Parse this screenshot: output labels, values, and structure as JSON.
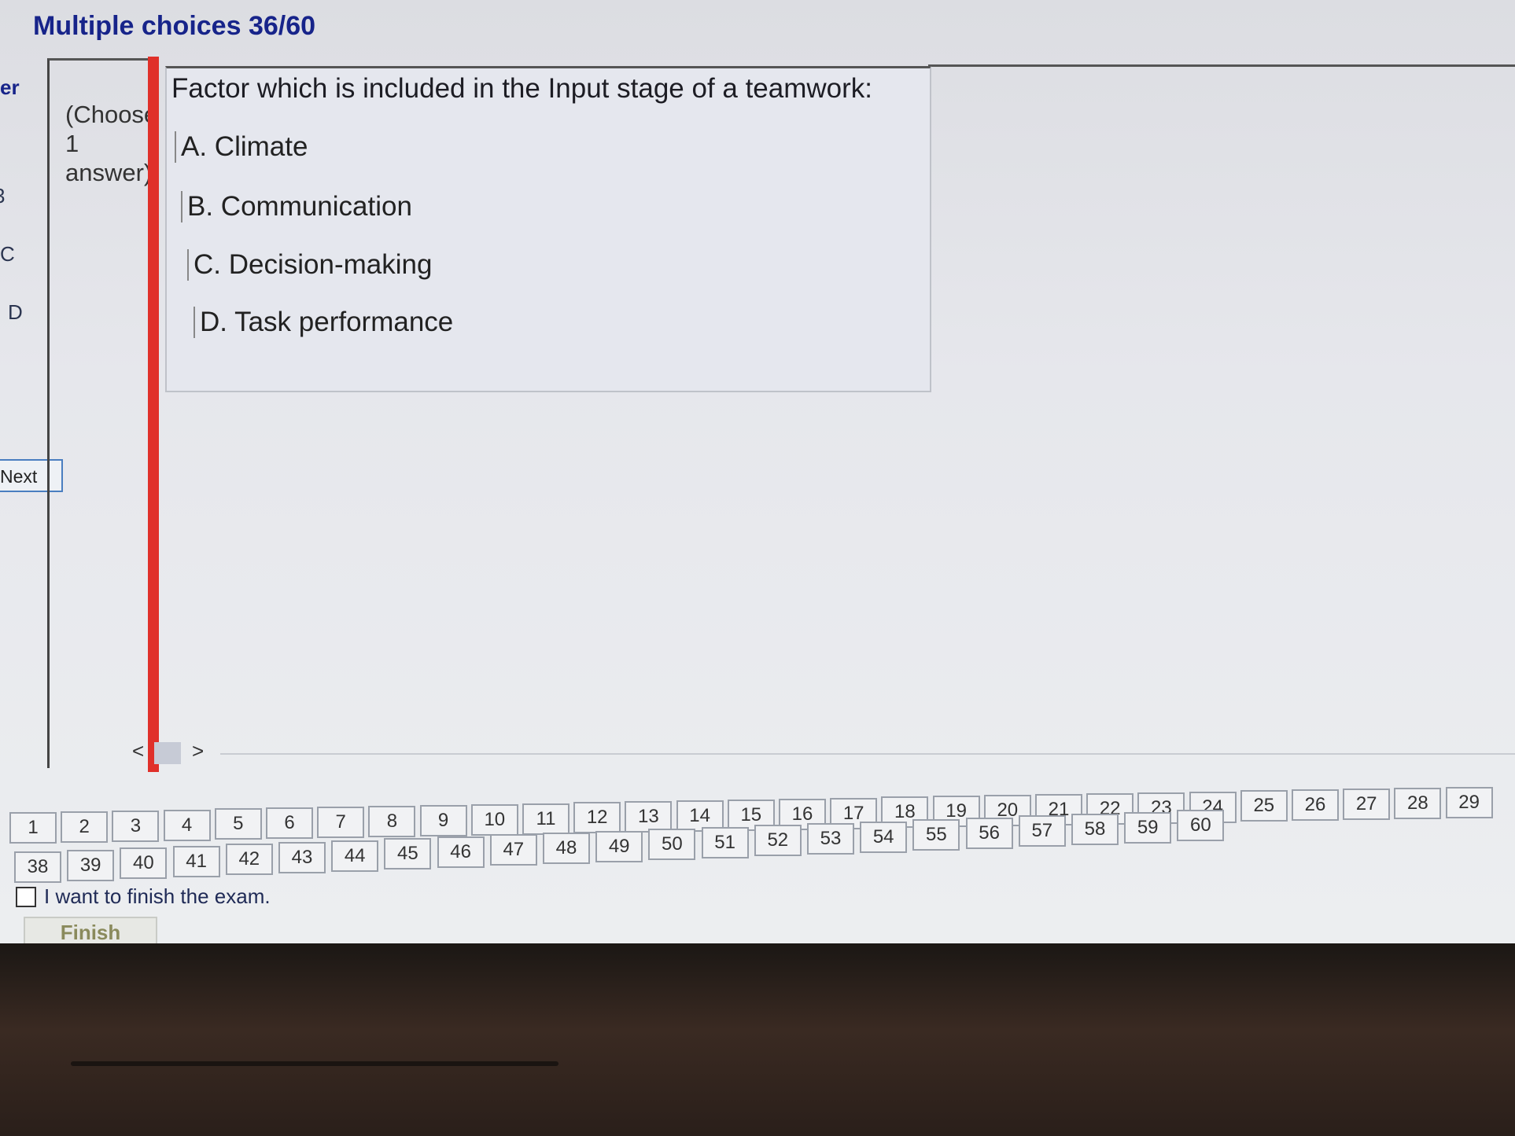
{
  "header": {
    "title": "Multiple choices 36/60"
  },
  "side_fragments": [
    "er",
    "3",
    "C",
    "D"
  ],
  "navigation": {
    "next_label": "Next",
    "prev_arrow": "<",
    "next_arrow": ">"
  },
  "question": {
    "instruction": "(Choose 1 answer)",
    "text": "Factor which is included in the Input stage of a teamwork:",
    "options": [
      "A.  Climate",
      "B.  Communication",
      "C.  Decision-making",
      "D.  Task performance"
    ]
  },
  "question_grid": {
    "row1": [
      "1",
      "2",
      "3",
      "4",
      "5",
      "6",
      "7",
      "8",
      "9",
      "10",
      "11",
      "12",
      "13",
      "14",
      "15",
      "16",
      "17",
      "18",
      "19",
      "20",
      "21",
      "22",
      "23",
      "24",
      "25",
      "26",
      "27",
      "28",
      "29"
    ],
    "row2": [
      "38",
      "39",
      "40",
      "41",
      "42",
      "43",
      "44",
      "45",
      "46",
      "47",
      "48",
      "49",
      "50",
      "51",
      "52",
      "53",
      "54",
      "55",
      "56",
      "57",
      "58",
      "59",
      "60"
    ]
  },
  "finish": {
    "checkbox_label": "I want to finish the exam.",
    "button_label": "Finish"
  }
}
